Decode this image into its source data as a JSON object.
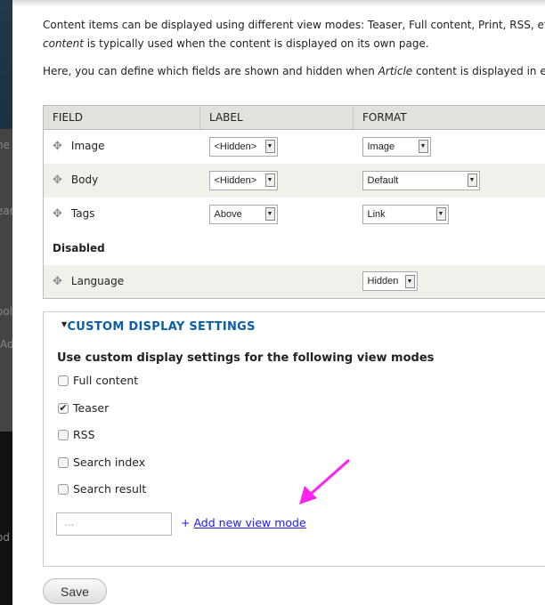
{
  "sidebar_fragments": [
    "ne",
    "ear",
    "ool",
    "Ad",
    "od"
  ],
  "intro": {
    "line1": "Content items can be displayed using different view modes: Teaser, Full content, Print, RSS, etc.",
    "line2_em": "content",
    "line2_rest": " is typically used when the content is displayed on its own page.",
    "p2_start": "Here, you can define which fields are shown and hidden when ",
    "p2_em": "Article",
    "p2_end": " content is displayed in each"
  },
  "table": {
    "headers": [
      "FIELD",
      "LABEL",
      "FORMAT"
    ],
    "rows": [
      {
        "field": "Image",
        "label": "<Hidden>",
        "format": "Image"
      },
      {
        "field": "Body",
        "label": "<Hidden>",
        "format": "Default"
      },
      {
        "field": "Tags",
        "label": "Above",
        "format": "Link"
      }
    ],
    "disabled_label": "Disabled",
    "disabled_rows": [
      {
        "field": "Language",
        "format": "Hidden"
      }
    ]
  },
  "custom": {
    "legend": "CUSTOM DISPLAY SETTINGS",
    "subtitle": "Use custom display settings for the following view modes",
    "modes": [
      {
        "label": "Full content",
        "checked": false
      },
      {
        "label": "Teaser",
        "checked": true
      },
      {
        "label": "RSS",
        "checked": false
      },
      {
        "label": "Search index",
        "checked": false
      },
      {
        "label": "Search result",
        "checked": false
      }
    ],
    "new_mode_placeholder": "...",
    "add_plus": "+",
    "add_link": "Add new view mode"
  },
  "save_label": "Save",
  "colors": {
    "link": "#0a5fa8",
    "annotation_arrow": "#ff22ee"
  }
}
